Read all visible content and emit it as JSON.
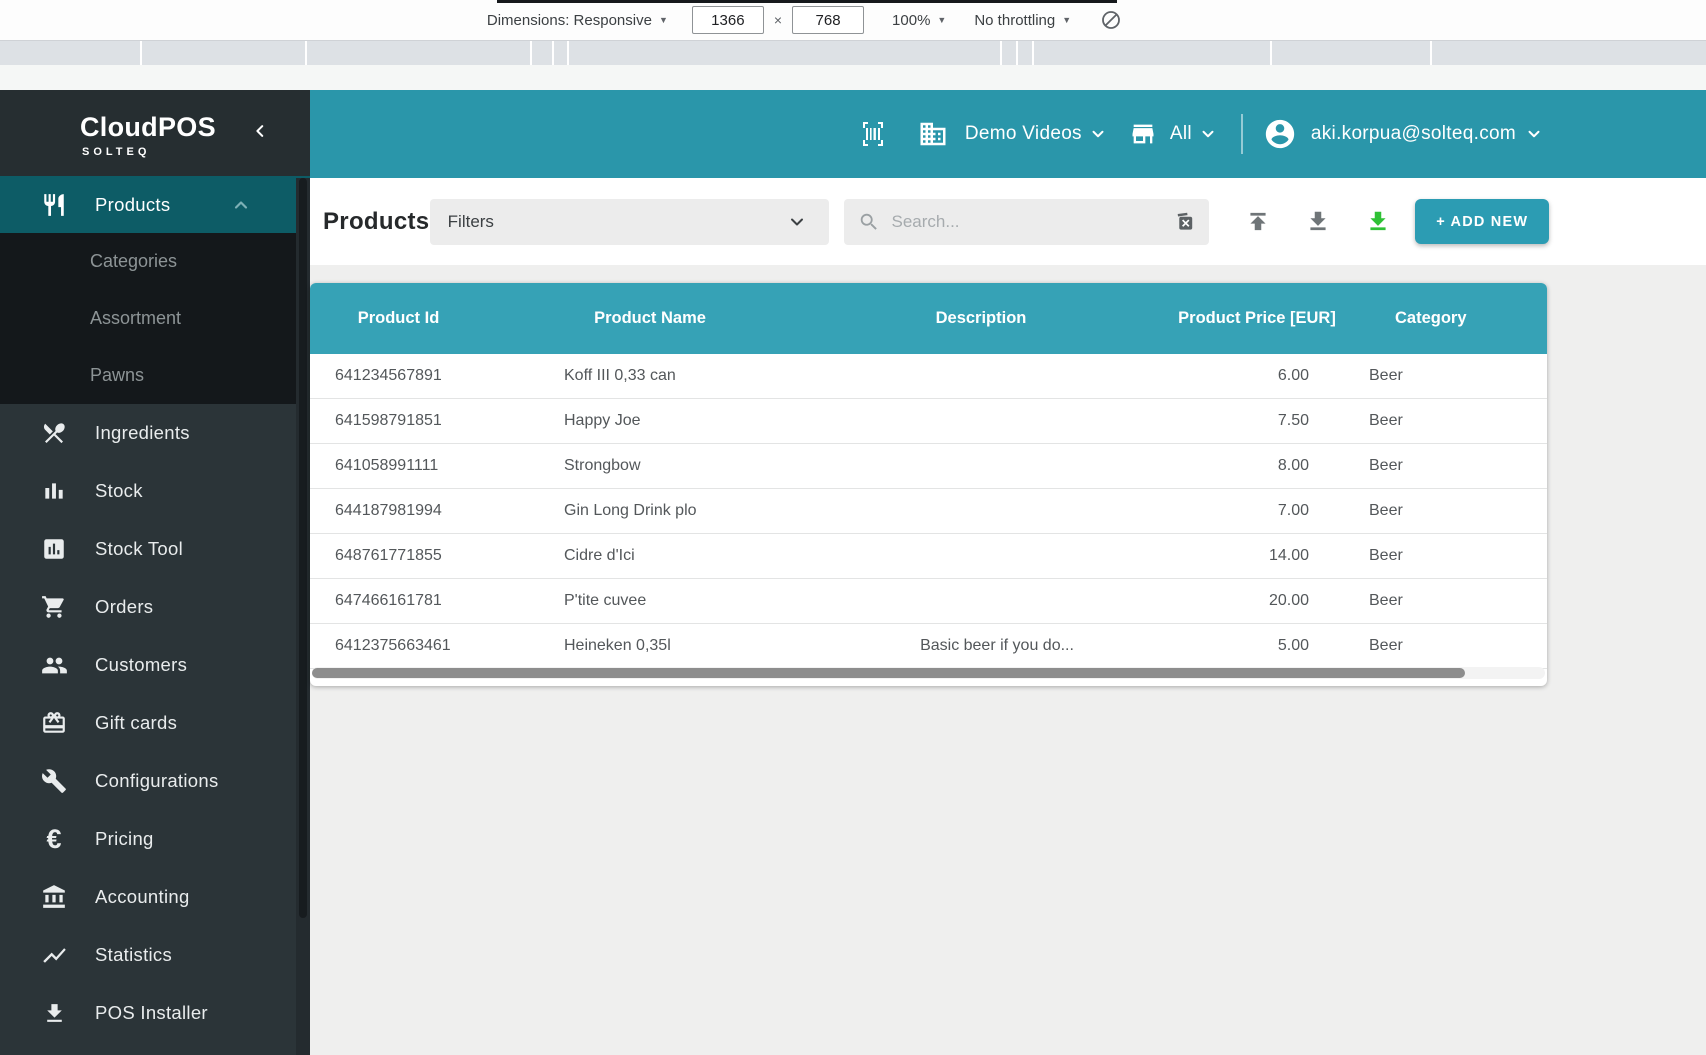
{
  "devtools": {
    "dimensions_label": "Dimensions: Responsive",
    "viewport_width": "1366",
    "times_symbol": "×",
    "viewport_height": "768",
    "zoom_level": "100%",
    "throttling": "No throttling"
  },
  "sidebar": {
    "logo": "CloudPOS",
    "logo_sub": "SOLTEQ",
    "products_group": {
      "label": "Products",
      "expanded": true,
      "subitems": [
        {
          "label": "Categories"
        },
        {
          "label": "Assortment"
        },
        {
          "label": "Pawns"
        }
      ]
    },
    "items": [
      {
        "label": "Ingredients",
        "icon": "restaurant-menu-icon"
      },
      {
        "label": "Stock",
        "icon": "bar-chart-icon"
      },
      {
        "label": "Stock Tool",
        "icon": "chart-box-icon"
      },
      {
        "label": "Orders",
        "icon": "shopping-cart-icon"
      },
      {
        "label": "Customers",
        "icon": "people-icon"
      },
      {
        "label": "Gift cards",
        "icon": "gift-card-icon"
      },
      {
        "label": "Configurations",
        "icon": "wrench-icon"
      },
      {
        "label": "Pricing",
        "icon": "euro-icon",
        "glyph": "€"
      },
      {
        "label": "Accounting",
        "icon": "bank-icon"
      },
      {
        "label": "Statistics",
        "icon": "trend-line-icon"
      },
      {
        "label": "POS Installer",
        "icon": "download-icon"
      }
    ]
  },
  "header": {
    "company": "Demo Videos",
    "store_filter": "All",
    "user_email": "aki.korpua@solteq.com"
  },
  "toolbar": {
    "page_title": "Products",
    "filters_label": "Filters",
    "search_placeholder": "Search...",
    "add_new_label": "+ ADD NEW"
  },
  "table": {
    "columns": [
      "Product Id",
      "Product Name",
      "Description",
      "Product Price [EUR]",
      "Category"
    ],
    "rows": [
      {
        "id": "641234567891",
        "name": "Koff III 0,33 can",
        "description": "",
        "price": "6.00",
        "category": "Beer"
      },
      {
        "id": "641598791851",
        "name": "Happy Joe",
        "description": "",
        "price": "7.50",
        "category": "Beer"
      },
      {
        "id": "641058991111",
        "name": "Strongbow",
        "description": "",
        "price": "8.00",
        "category": "Beer"
      },
      {
        "id": "644187981994",
        "name": "Gin Long Drink plo",
        "description": "",
        "price": "7.00",
        "category": "Beer"
      },
      {
        "id": "648761771855",
        "name": "Cidre d'Ici",
        "description": "",
        "price": "14.00",
        "category": "Beer"
      },
      {
        "id": "647466161781",
        "name": "P'tite cuvee",
        "description": "",
        "price": "20.00",
        "category": "Beer"
      },
      {
        "id": "6412375663461",
        "name": "Heineken 0,35l",
        "description": "Basic beer if you do...",
        "price": "5.00",
        "category": "Beer"
      }
    ]
  },
  "colors": {
    "app_header_teal": "#2a96aa",
    "table_header_teal": "#36a2b6",
    "active_nav_teal": "#0d5c66",
    "sidebar_dark": "#2b3438",
    "sidebar_submenu_dark": "#14181b",
    "add_button_teal": "#2c9cb3",
    "download_green": "#2fc135",
    "page_background": "#efefee"
  },
  "icons": {
    "rotate": "slashed-circle",
    "chevron_down": "v",
    "chevron_up": "^",
    "chevron_left": "<",
    "search": "magnifier"
  }
}
